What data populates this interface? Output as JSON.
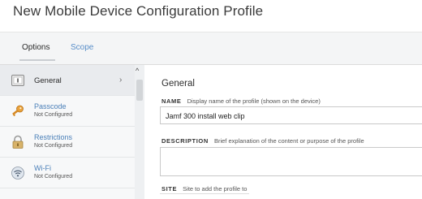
{
  "header": {
    "title": "New Mobile Device Configuration Profile"
  },
  "tabs": [
    {
      "label": "Options"
    },
    {
      "label": "Scope"
    }
  ],
  "sidebar": {
    "items": [
      {
        "label": "General",
        "icon": "general-icon",
        "selected": true
      },
      {
        "label": "Passcode",
        "status": "Not Configured",
        "icon": "key-icon"
      },
      {
        "label": "Restrictions",
        "status": "Not Configured",
        "icon": "lock-icon"
      },
      {
        "label": "Wi-Fi",
        "status": "Not Configured",
        "icon": "wifi-icon"
      }
    ]
  },
  "main": {
    "section_title": "General",
    "fields": {
      "name": {
        "label": "NAME",
        "hint": "Display name of the profile (shown on the device)",
        "value": "Jamf 300 install web clip"
      },
      "description": {
        "label": "DESCRIPTION",
        "hint": "Brief explanation of the content or purpose of the profile",
        "value": ""
      },
      "site": {
        "label": "SITE",
        "hint": "Site to add the profile to"
      }
    }
  },
  "colors": {
    "link": "#4a7fb8",
    "scope_tab": "#5a8fc9",
    "selected_bg": "#e9ebee"
  }
}
